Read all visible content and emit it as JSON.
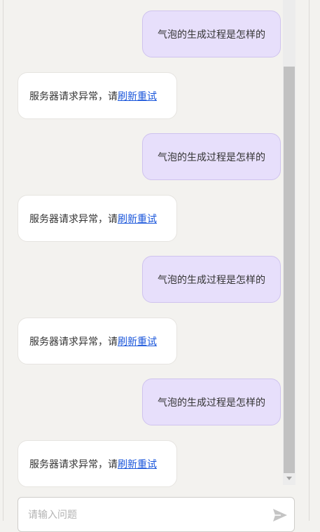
{
  "chat": {
    "messages": [
      {
        "role": "user",
        "text": "气泡的生成过程是怎样的"
      },
      {
        "role": "bot",
        "text": "服务器请求异常，请",
        "link": "刷新重试"
      },
      {
        "role": "user",
        "text": "气泡的生成过程是怎样的"
      },
      {
        "role": "bot",
        "text": "服务器请求异常，请",
        "link": "刷新重试"
      },
      {
        "role": "user",
        "text": "气泡的生成过程是怎样的"
      },
      {
        "role": "bot",
        "text": "服务器请求异常，请",
        "link": "刷新重试"
      },
      {
        "role": "user",
        "text": "气泡的生成过程是怎样的"
      },
      {
        "role": "bot",
        "text": "服务器请求异常，请",
        "link": "刷新重试"
      }
    ]
  },
  "input": {
    "placeholder": "请输入问题",
    "send_icon": "send-icon"
  },
  "colors": {
    "user_bubble": "#e7dffb",
    "bot_bubble": "#ffffff",
    "link": "#1a56db",
    "background": "#f3f2ef"
  }
}
